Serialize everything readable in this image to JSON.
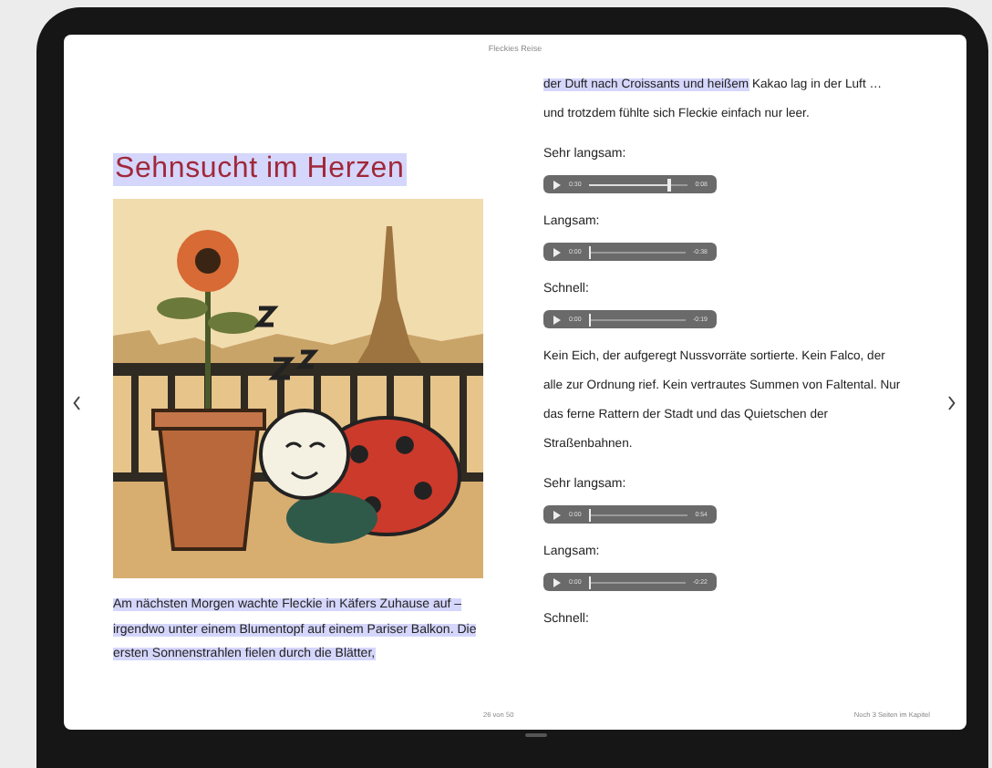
{
  "header": {
    "title": "Fleckies Reise"
  },
  "left_page": {
    "title": {
      "text": "Sehnsucht im Herzen",
      "highlighted": true
    },
    "paragraph": [
      {
        "text": "Am nächsten Morgen wachte Fleckie in Käfers Zuhause auf – irgendwo unter einem Blumentopf auf einem Pariser Balkon. Die ersten Sonnenstrahlen fielen durch die Blätter,",
        "highlighted": true
      }
    ]
  },
  "right_page": {
    "blocks": [
      {
        "kind": "text",
        "segments": [
          {
            "text": "der Duft nach Croissants und heißem",
            "highlighted": true
          },
          {
            "text": " Kakao lag in der Luft … und trotzdem fühlte sich Fleckie einfach nur leer.",
            "highlighted": false
          }
        ]
      },
      {
        "kind": "label",
        "text": "Sehr langsam:"
      },
      {
        "kind": "audio",
        "elapsed": "0:30",
        "remaining": "0:08",
        "level": 0.8
      },
      {
        "kind": "label",
        "text": "Langsam:"
      },
      {
        "kind": "audio",
        "elapsed": "0:00",
        "remaining": "-0:38",
        "level": 0.0
      },
      {
        "kind": "label",
        "text": "Schnell:"
      },
      {
        "kind": "audio",
        "elapsed": "0:00",
        "remaining": "-0:19",
        "level": 0.0
      },
      {
        "kind": "text",
        "segments": [
          {
            "text": "Kein Eich, der aufgeregt Nussvorräte sortierte. Kein Falco, der alle zur Ordnung rief. Kein vertrautes Summen von Faltental. Nur das ferne Rattern der Stadt und das Quietschen der Straßenbahnen.",
            "highlighted": false
          }
        ]
      },
      {
        "kind": "label",
        "text": "Sehr langsam:"
      },
      {
        "kind": "audio",
        "elapsed": "0:00",
        "remaining": "0:54",
        "level": 0.0
      },
      {
        "kind": "label",
        "text": "Langsam:"
      },
      {
        "kind": "audio",
        "elapsed": "0:00",
        "remaining": "-0:22",
        "level": 0.0
      },
      {
        "kind": "label",
        "text": "Schnell:"
      }
    ]
  },
  "footer": {
    "page": "26 von 50",
    "chapter_remaining": "Noch 3 Seiten im Kapitel"
  }
}
